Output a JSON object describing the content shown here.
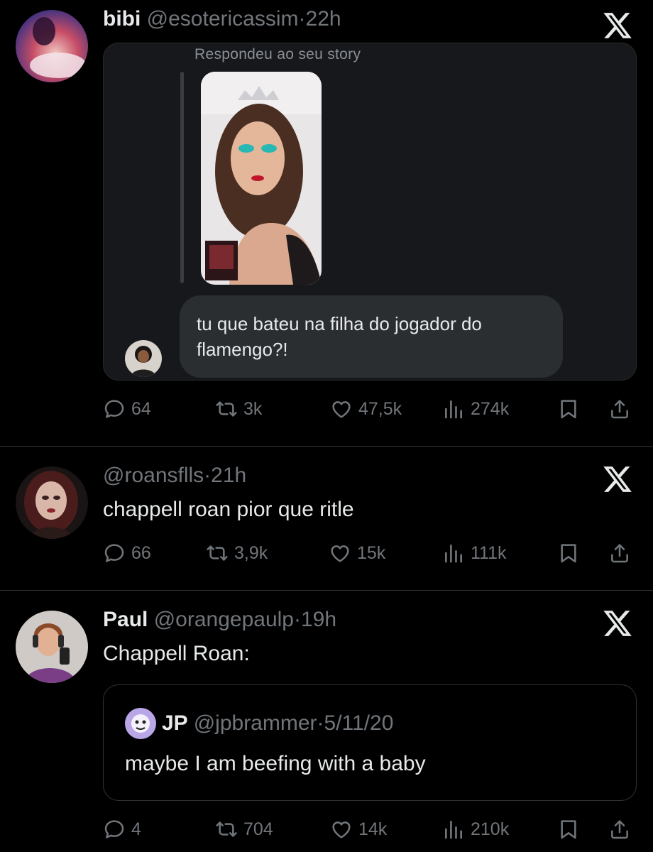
{
  "posts": [
    {
      "name": "bibi",
      "handle": "@esotericassim",
      "dot": "·",
      "time": "22h",
      "story": {
        "caption": "Respondeu ao seu story",
        "reply": "tu que bateu na filha do jogador do flamengo?!"
      },
      "stats": {
        "replies": "64",
        "reposts": "3k",
        "likes": "47,5k",
        "views": "274k"
      }
    },
    {
      "name": "",
      "handle": "@roansflls",
      "dot": "·",
      "time": "21h",
      "text": "chappell roan pior que ritle",
      "stats": {
        "replies": "66",
        "reposts": "3,9k",
        "likes": "15k",
        "views": "111k"
      }
    },
    {
      "name": "Paul",
      "handle": "@orangepaulp",
      "dot": "·",
      "time": "19h",
      "text": "Chappell Roan:",
      "quote": {
        "name": "JP",
        "handle": "@jpbrammer",
        "dot": "·",
        "time": "5/11/20",
        "text": "maybe I am beefing with a baby"
      },
      "stats": {
        "replies": "4",
        "reposts": "704",
        "likes": "14k",
        "views": "210k"
      }
    }
  ],
  "icons": [
    "x-logo-icon",
    "reply-icon",
    "repost-icon",
    "like-icon",
    "views-icon",
    "bookmark-icon",
    "share-icon"
  ],
  "colors": {
    "background": "#000000",
    "text": "#e7e9ea",
    "muted": "#71767b",
    "border": "#2f3336",
    "bubble": "#2b2e31"
  }
}
